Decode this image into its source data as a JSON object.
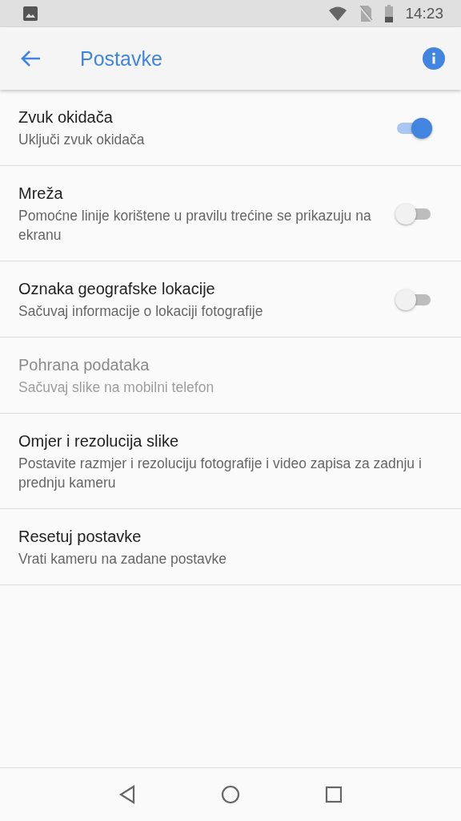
{
  "status_bar": {
    "time": "14:23"
  },
  "app_bar": {
    "title": "Postavke"
  },
  "settings": [
    {
      "kind": "switch",
      "title": "Zvuk okidača",
      "subtitle": "Uključi zvuk okidača",
      "on": true,
      "disabled": false
    },
    {
      "kind": "switch",
      "title": "Mreža",
      "subtitle": "Pomoćne linije korištene u pravilu trećine se prikazuju na ekranu",
      "on": false,
      "disabled": false
    },
    {
      "kind": "switch",
      "title": "Oznaka geografske lokacije",
      "subtitle": "Sačuvaj informacije o lokaciji fotografije",
      "on": false,
      "disabled": false
    },
    {
      "kind": "plain",
      "title": "Pohrana podataka",
      "subtitle": "Sačuvaj slike na mobilni telefon",
      "disabled": true
    },
    {
      "kind": "plain",
      "title": "Omjer i rezolucija slike",
      "subtitle": "Postavite razmjer i rezoluciju fotografije i video zapisa za zadnju i prednju kameru",
      "disabled": false
    },
    {
      "kind": "plain",
      "title": "Resetuj postavke",
      "subtitle": "Vrati kameru na zadane postavke",
      "disabled": false
    }
  ]
}
